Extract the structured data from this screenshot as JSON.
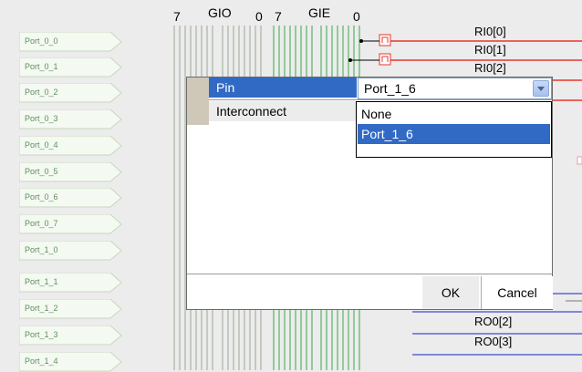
{
  "ports": [
    "Port_0_0",
    "Port_0_1",
    "Port_0_2",
    "Port_0_3",
    "Port_0_4",
    "Port_0_5",
    "Port_0_6",
    "Port_0_7",
    "Port_1_0",
    "Port_1_1",
    "Port_1_2",
    "Port_1_3",
    "Port_1_4"
  ],
  "bus_headers": {
    "gio_hi": "7",
    "gio": "GIO",
    "gio_lo": "0",
    "gie_hi": "7",
    "gie": "GIE",
    "gie_lo": "0"
  },
  "right_signals": {
    "ri0_0": "RI0[0]",
    "ri0_1": "RI0[1]",
    "ri0_2": "RI0[2]",
    "ro0_2": "RO0[2]",
    "ro0_3": "RO0[3]"
  },
  "dialog": {
    "rows": [
      {
        "label": "Pin"
      },
      {
        "label": "Interconnect"
      }
    ],
    "select": {
      "value": "Port_1_6"
    },
    "dropdown": {
      "options": [
        "None",
        "Port_1_6"
      ],
      "selected": "Port_1_6"
    },
    "buttons": {
      "ok": "OK",
      "cancel": "Cancel"
    }
  },
  "colors": {
    "pin_red": "#e8362c",
    "bus_blue": "#5a66d6",
    "wire_green": "#3aa84a",
    "selection": "#316ac5"
  }
}
